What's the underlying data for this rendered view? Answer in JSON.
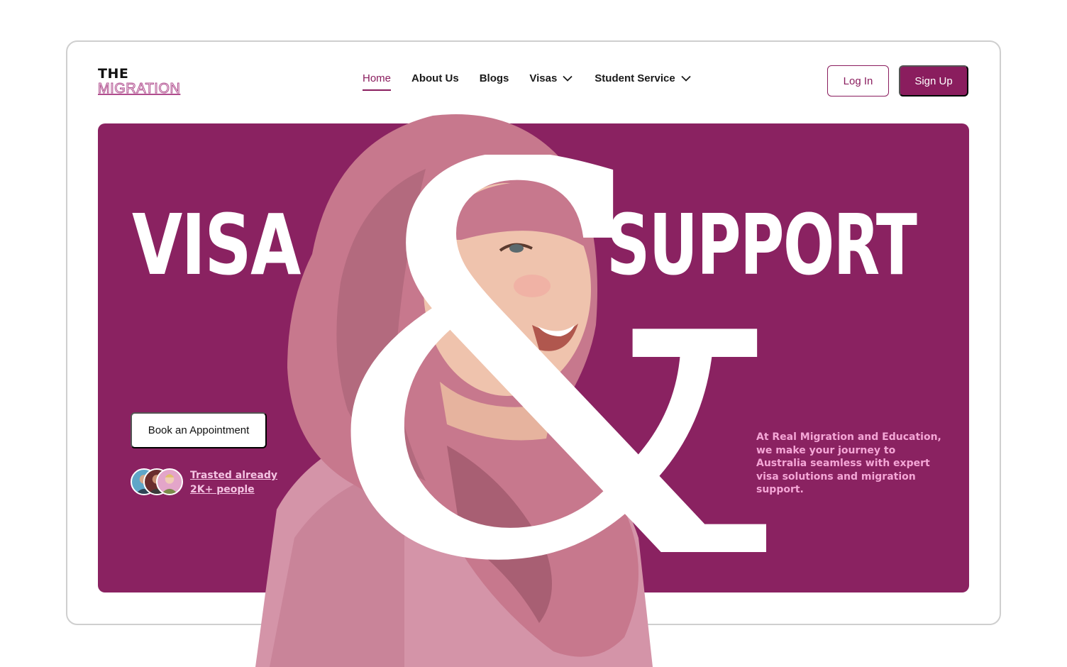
{
  "brand": {
    "line1": "THE",
    "line2": "MIGRATION"
  },
  "nav": {
    "items": [
      {
        "label": "Home",
        "active": true,
        "dropdown": false
      },
      {
        "label": "About Us",
        "active": false,
        "dropdown": false
      },
      {
        "label": "Blogs",
        "active": false,
        "dropdown": false
      },
      {
        "label": "Visas",
        "active": false,
        "dropdown": true
      },
      {
        "label": "Student Service",
        "active": false,
        "dropdown": true
      }
    ]
  },
  "auth": {
    "login_label": "Log In",
    "signup_label": "Sign Up"
  },
  "hero": {
    "word_left": "VISA",
    "ampersand": "&",
    "word_right": "SUPPORT",
    "cta_label": "Book an Appointment",
    "trust_line1": "Trasted already",
    "trust_line2": "2K+ people",
    "description": "At Real Migration and Education, we make your journey to Australia seamless with expert visa solutions and migration support."
  },
  "colors": {
    "brand": "#8a1d5e",
    "hero_bg": "#8a2261",
    "accent_text": "#f4a6d6",
    "hijab": "#c87b8f",
    "skin": "#efc3ad"
  },
  "icons": {
    "dropdown": "chevron-down-icon"
  }
}
